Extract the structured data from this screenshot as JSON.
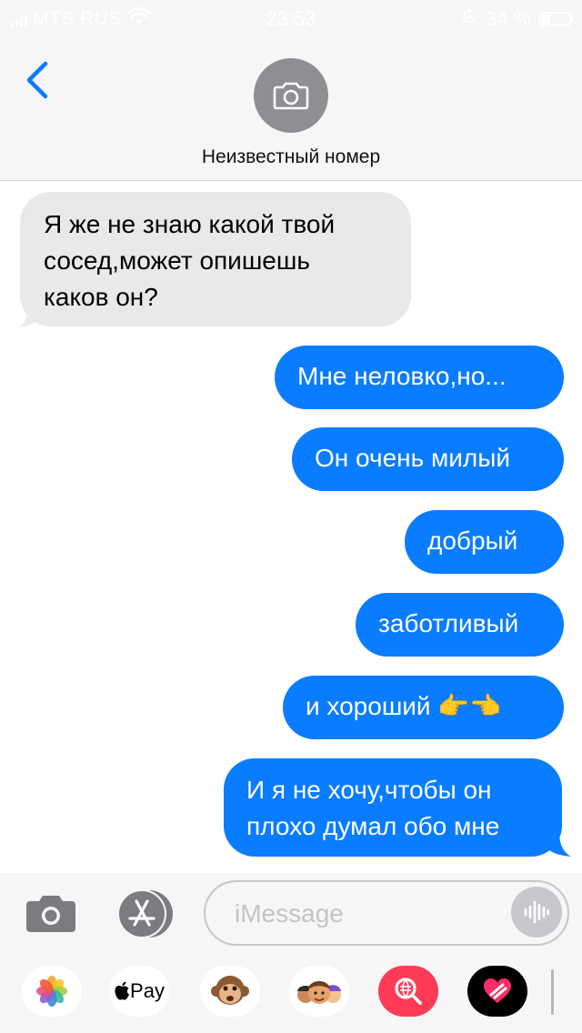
{
  "status_bar": {
    "carrier": "MTS RUS",
    "time": "23:53",
    "battery_text": "34 %",
    "battery_level": 0.34,
    "icons": [
      "signal-icon",
      "wifi-icon",
      "rotation-lock-icon",
      "battery-icon"
    ]
  },
  "header": {
    "contact_name": "Неизвестный номер",
    "back_icon": "chevron-left-icon",
    "avatar_icon": "camera-icon"
  },
  "messages": [
    {
      "direction": "incoming",
      "lines": [
        "Я же не знаю какой твой",
        "сосед,может опишешь",
        "каков он?"
      ]
    },
    {
      "direction": "outgoing",
      "lines": [
        "Мне неловко,но..."
      ]
    },
    {
      "direction": "outgoing",
      "lines": [
        "Он очень милый"
      ]
    },
    {
      "direction": "outgoing",
      "lines": [
        "добрый"
      ]
    },
    {
      "direction": "outgoing",
      "lines": [
        "заботливый"
      ]
    },
    {
      "direction": "outgoing",
      "lines": [
        "и хороший 👉👈"
      ]
    },
    {
      "direction": "outgoing",
      "lines": [
        "И я не хочу,чтобы он",
        "плохо думал обо мне"
      ]
    }
  ],
  "input_bar": {
    "placeholder": "iMessage",
    "icons": [
      "camera-icon",
      "app-store-icon",
      "audio-waveform-icon"
    ]
  },
  "app_drawer": {
    "apple_pay_label": "Pay",
    "items": [
      "photos-app-icon",
      "apple-pay-icon",
      "animoji-monkey-icon",
      "memoji-icon",
      "web-search-icon",
      "digital-touch-icon"
    ]
  },
  "colors": {
    "outgoing_bubble": "#0a7cff",
    "incoming_bubble": "#e9e9eb",
    "header_background": "#f6f6f7",
    "accent": "#0a7cff"
  }
}
